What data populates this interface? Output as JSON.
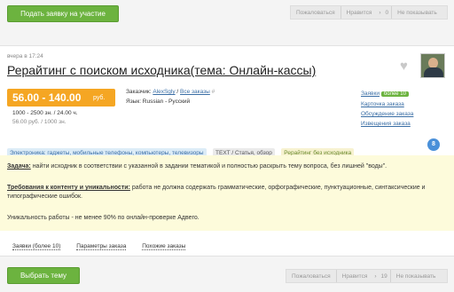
{
  "top_bar": {
    "submit_label": "Подать заявку на участие",
    "complain_label": "Пожаловаться",
    "like_label": "Нравится",
    "like_count": "0",
    "hide_label": "Не показывать"
  },
  "order": {
    "posted": "вчера в 17:24",
    "title": "Рерайтинг с поиском исходника(тема: Онлайн-кассы)",
    "price": "56.00 - 140.00",
    "price_unit": "руб.",
    "volume": "1000 - 2500 зн. / 24.00 ч.",
    "rate": "56.00 руб. / 1000 зн.",
    "customer_label": "Заказчик:",
    "customer_name": "AlexSgly",
    "all_orders": "Все заказы",
    "lang_label": "Язык: Russian - Русский",
    "side_links": {
      "applications": "Заявки",
      "applications_badge": "более 10",
      "card": "Карточка заказа",
      "discussion": "Обсуждение заказа",
      "notices": "Извещения заказа"
    },
    "tags": [
      "Электроника: гаджеты, мобильные телефоны, компьютеры, телевизоры",
      "TEXT / Статья, обзор",
      "Рерайтинг без исходника"
    ],
    "task_label": "Задача:",
    "task_text": "найти исходник в соответствии с указанной в задании тематикой и полностью раскрыть тему вопроса, без лишней \"воды\".",
    "req_label": "Требования к контенту и уникальности:",
    "req_text": "работа не должна содержать грамматические, орфографические, пунктуационные, синтаксические и типографические ошибок.",
    "uniqueness_text": "Уникальность работы - не менее 90% по онлайн-проверке Адвего.",
    "badge_number": "8",
    "tabs": [
      "Заявки (более 10)",
      "Параметры заказа",
      "Похожие заказы"
    ]
  },
  "bottom_bar": {
    "choose_label": "Выбрать тему",
    "complain_label": "Пожаловаться",
    "like_label": "Нравится",
    "like_count": "19",
    "hide_label": "Не показывать"
  },
  "icons": [
    "heart-icon",
    "avatar",
    "arrow-right-icon",
    "eye-icon",
    "gear-icon"
  ],
  "colors": {
    "accent_green": "#6cb33f",
    "price_orange": "#f5a623",
    "link_blue": "#3a6ea5",
    "task_bg": "#fdfbdb"
  }
}
